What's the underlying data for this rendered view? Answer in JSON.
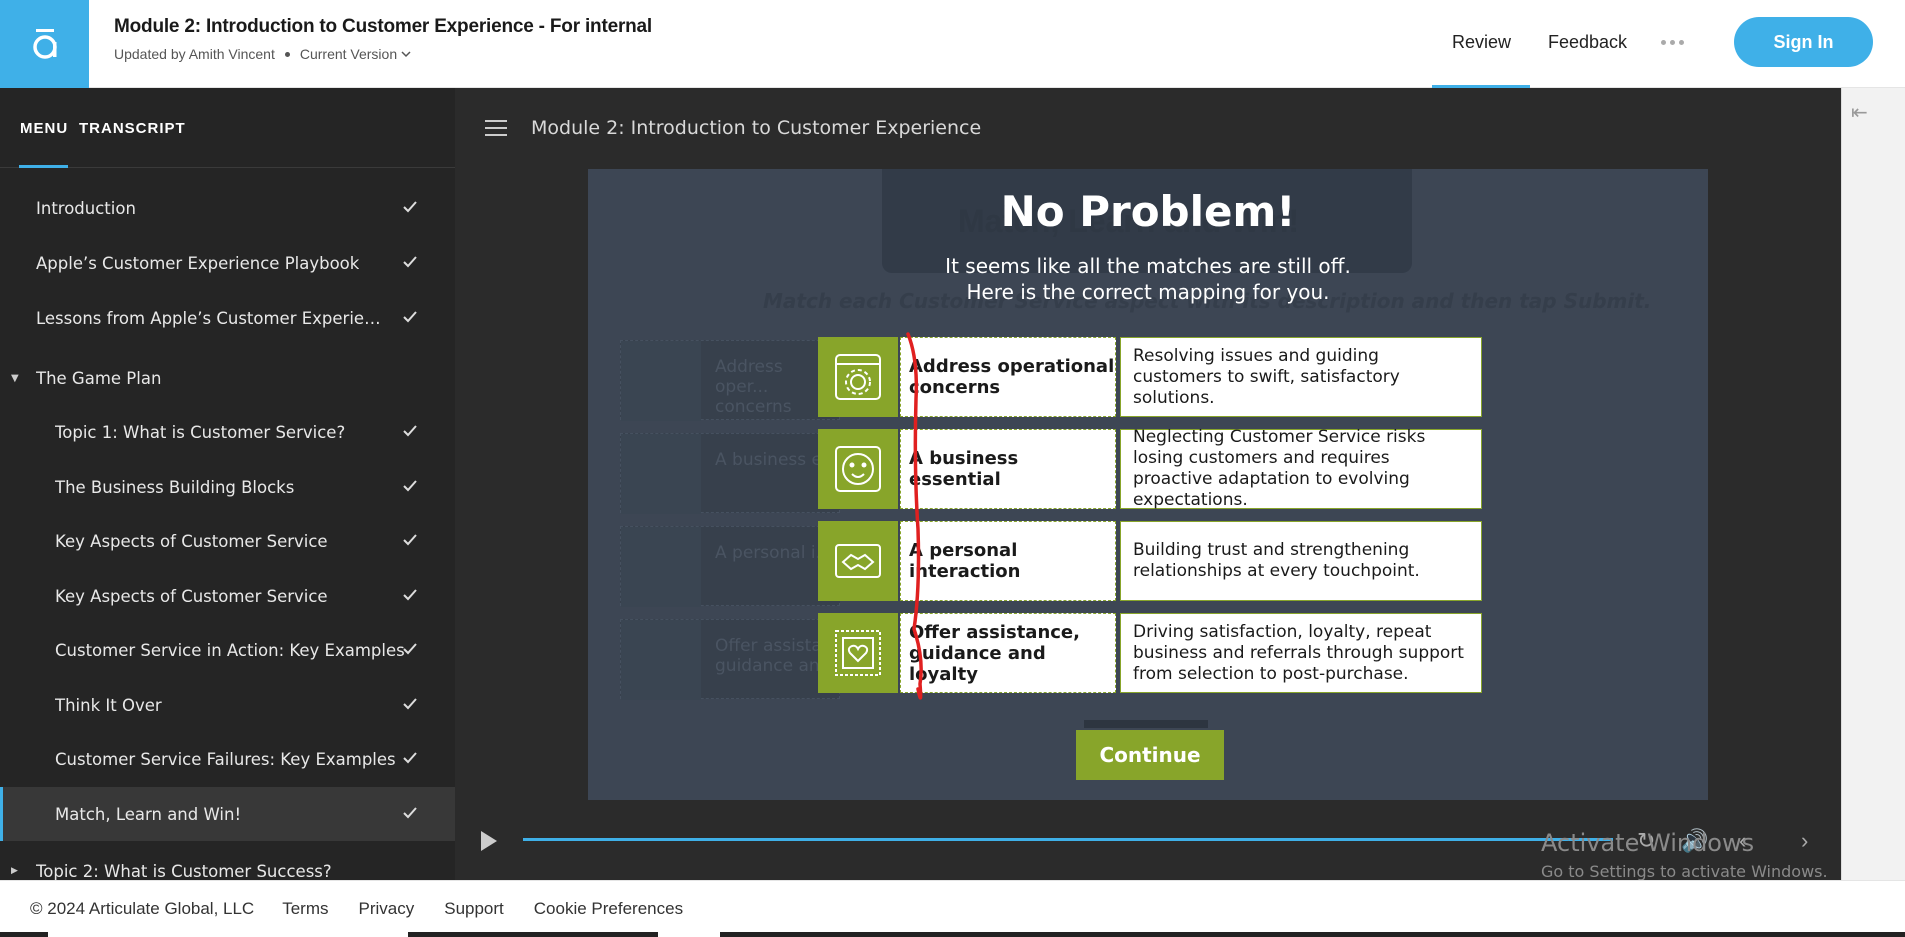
{
  "header": {
    "title": "Module 2: Introduction to Customer Experience - For internal",
    "updated_by": "Updated by Amith Vincent",
    "version": "Current Version",
    "nav": {
      "review": "Review",
      "feedback": "Feedback"
    },
    "signin": "Sign In",
    "accent": "#3fb0e8"
  },
  "sidebar": {
    "tabs": [
      "MENU",
      "TRANSCRIPT"
    ],
    "items": [
      {
        "label": "Introduction",
        "done": true
      },
      {
        "label": "Apple’s Customer Experience Playbook",
        "done": true
      },
      {
        "label": "Lessons from Apple’s Customer Experienc...",
        "done": true
      },
      {
        "label": "The Game Plan",
        "done": false,
        "expanded": true
      },
      {
        "label": "Topic 1: What is Customer Service?",
        "done": true
      },
      {
        "label": "The Business Building Blocks",
        "done": true
      },
      {
        "label": "Key Aspects of Customer Service",
        "done": true
      },
      {
        "label": "Key Aspects of Customer Service",
        "done": true
      },
      {
        "label": "Customer Service in Action: Key Examples",
        "done": true
      },
      {
        "label": "Think It Over",
        "done": true
      },
      {
        "label": "Customer Service Failures: Key Examples",
        "done": true
      },
      {
        "label": "Match, Learn and Win!",
        "done": true,
        "active": true
      },
      {
        "label": "Topic 2: What is Customer Success?",
        "done": false
      }
    ]
  },
  "main": {
    "module_title": "Module 2: Introduction to Customer Experience"
  },
  "slide": {
    "bg_title": "Match, Learn and Win!",
    "bg_instruction": "Match each Customer Service aspect with its description and then tap Submit.",
    "bg_rows": [
      "Address oper... concerns",
      "A business e...",
      "A personal i...",
      "Offer assista... guidance an..."
    ],
    "title": "No Problem!",
    "message_line1": "It seems like all the matches are still off.",
    "message_line2": "Here is the correct mapping for you.",
    "rows": [
      {
        "icon": "gear-icon",
        "left": "Address operational concerns",
        "right": "Resolving issues and guiding customers to swift, satisfactory solutions."
      },
      {
        "icon": "smiley-face-icon",
        "left": "A business essential",
        "right": "Neglecting Customer Service risks losing customers and requires proactive adaptation to evolving expectations."
      },
      {
        "icon": "handshake-icon",
        "left": "A personal interaction",
        "right": "Building trust and strengthening relationships at every touchpoint."
      },
      {
        "icon": "heart-frame-icon",
        "left": "Offer assistance, guidance and loyalty",
        "right": "Driving satisfaction, loyalty, repeat business and referrals through support from selection to post-purchase."
      }
    ],
    "continue": "Continue",
    "accent": "#88a52a"
  },
  "watermark": {
    "line1": "Activate Windows",
    "line2": "Go to Settings to activate Windows."
  },
  "footer": {
    "copyright": "© 2024 Articulate Global, LLC",
    "links": [
      "Terms",
      "Privacy",
      "Support",
      "Cookie Preferences"
    ]
  }
}
